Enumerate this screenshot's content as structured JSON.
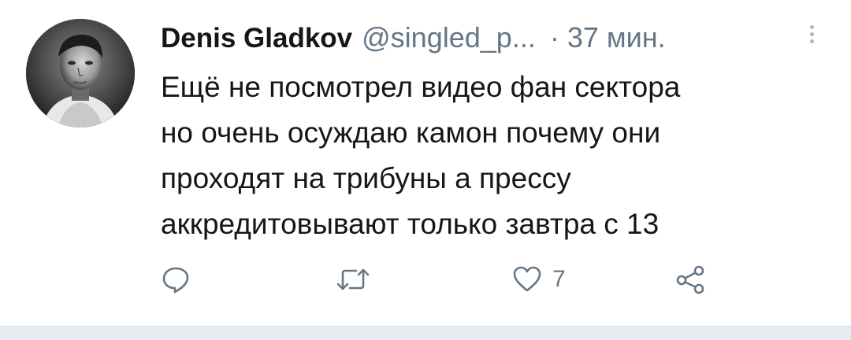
{
  "tweet": {
    "author_name": "Denis Gladkov",
    "handle": "@singled_p...",
    "separator": "·",
    "time": "37 мин.",
    "text_lines": [
      "Ещё не посмотрел видео фан сектора",
      "но очень осуждаю камон почему они",
      "проходят на трибуны а прессу",
      "аккредитовывают только завтра с 13"
    ],
    "actions": {
      "reply_icon": "reply-icon",
      "retweet_icon": "retweet-icon",
      "like_icon": "heart-icon",
      "like_count": "7",
      "share_icon": "share-icon"
    },
    "colors": {
      "primary_text": "#14171a",
      "secondary_text": "#657786",
      "divider": "#e6ecf0"
    }
  }
}
